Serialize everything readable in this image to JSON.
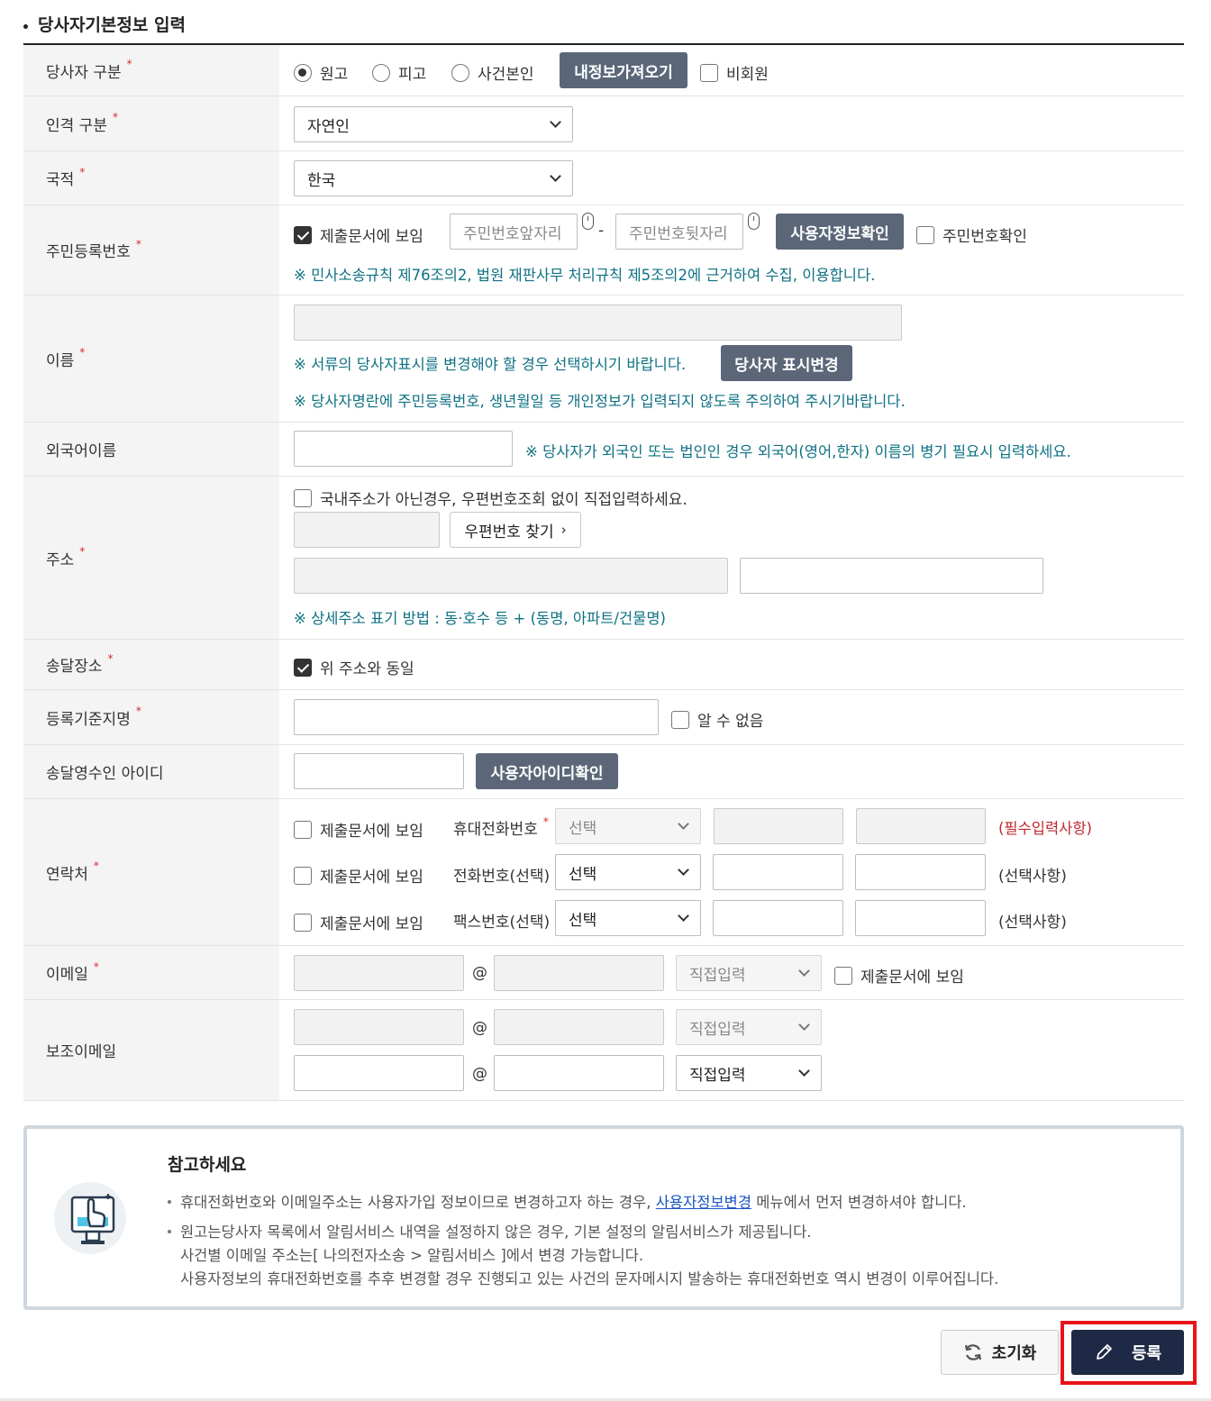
{
  "section_title": "당사자기본정보 입력",
  "rows": {
    "party_type": {
      "label": "당사자 구분",
      "options": [
        "원고",
        "피고",
        "사건본인"
      ],
      "selected": "원고",
      "load_button": "내정보가져오기",
      "non_member": "비회원"
    },
    "person_type": {
      "label": "인격 구분",
      "value": "자연인"
    },
    "nationality": {
      "label": "국적",
      "value": "한국"
    },
    "rrn": {
      "label": "주민등록번호",
      "show_in_doc": "제출문서에 보임",
      "front_placeholder": "주민번호앞자리",
      "dash": "-",
      "back_placeholder": "주민번호뒷자리",
      "verify_button": "사용자정보확인",
      "confirm": "주민번호확인",
      "note": "※ 민사소송규칙 제76조의2, 법원 재판사무 처리규칙 제5조의2에 근거하여 수집, 이용합니다."
    },
    "name": {
      "label": "이름",
      "note1": "※ 서류의 당사자표시를 변경해야 할 경우 선택하시기 바랍니다.",
      "change_button": "당사자 표시변경",
      "note2": "※ 당사자명란에 주민등록번호, 생년월일 등 개인정보가 입력되지 않도록 주의하여 주시기바랍니다."
    },
    "foreign_name": {
      "label": "외국어이름",
      "note": "※ 당사자가 외국인 또는 법인인 경우 외국어(영어,한자) 이름의 병기 필요시 입력하세요."
    },
    "address": {
      "label": "주소",
      "overseas": "국내주소가 아닌경우, 우편번호조회 없이 직접입력하세요.",
      "zip_button": "우편번호 찾기",
      "note": "※ 상세주소 표기 방법 : 동·호수 등 + (동명, 아파트/건물명)"
    },
    "delivery": {
      "label": "송달장소",
      "same": "위 주소와 동일"
    },
    "reg_place": {
      "label": "등록기준지명",
      "unknown": "알 수 없음"
    },
    "receiver_id": {
      "label": "송달영수인 아이디",
      "verify_button": "사용자아이디확인"
    },
    "contact": {
      "label": "연락처",
      "lines": [
        {
          "show": "제출문서에 보임",
          "type": "휴대전화번호",
          "required": true,
          "select": "선택",
          "hint": "(필수입력사항)"
        },
        {
          "show": "제출문서에 보임",
          "type": "전화번호(선택)",
          "required": false,
          "select": "선택",
          "hint": "(선택사항)"
        },
        {
          "show": "제출문서에 보임",
          "type": "팩스번호(선택)",
          "required": false,
          "select": "선택",
          "hint": "(선택사항)"
        }
      ]
    },
    "email": {
      "label": "이메일",
      "at": "@",
      "domain_select": "직접입력",
      "show": "제출문서에 보임"
    },
    "sub_email": {
      "label": "보조이메일",
      "at": "@",
      "domain_select": "직접입력"
    }
  },
  "required_mark": "*",
  "notice": {
    "title": "참고하세요",
    "line1_pre": "휴대전화번호와 이메일주소는 사용자가입 정보이므로 변경하고자 하는 경우,",
    "line1_link": "사용자정보변경",
    "line1_post": "메뉴에서 먼저 변경하셔야 합니다.",
    "line2": "원고는당사자 목록에서 알림서비스 내역을 설정하지 않은 경우, 기본 설정의 알림서비스가 제공됩니다.",
    "line3": "사건별 이메일 주소는[ 나의전자소송 > 알림서비스 ]에서 변경 가능합니다.",
    "line4": "사용자정보의 휴대전화번호를 추후 변경할 경우 진행되고 있는 사건의 문자메시지 발송하는 휴대전화번호 역시 변경이 이루어집니다."
  },
  "buttons": {
    "reset": "초기화",
    "submit": "등록"
  },
  "colors": {
    "accent_button": "#5b6778",
    "submit_button": "#1e2a45",
    "highlight_border": "#e8131a",
    "note_text": "#0e7183",
    "required": "#d9262c"
  }
}
